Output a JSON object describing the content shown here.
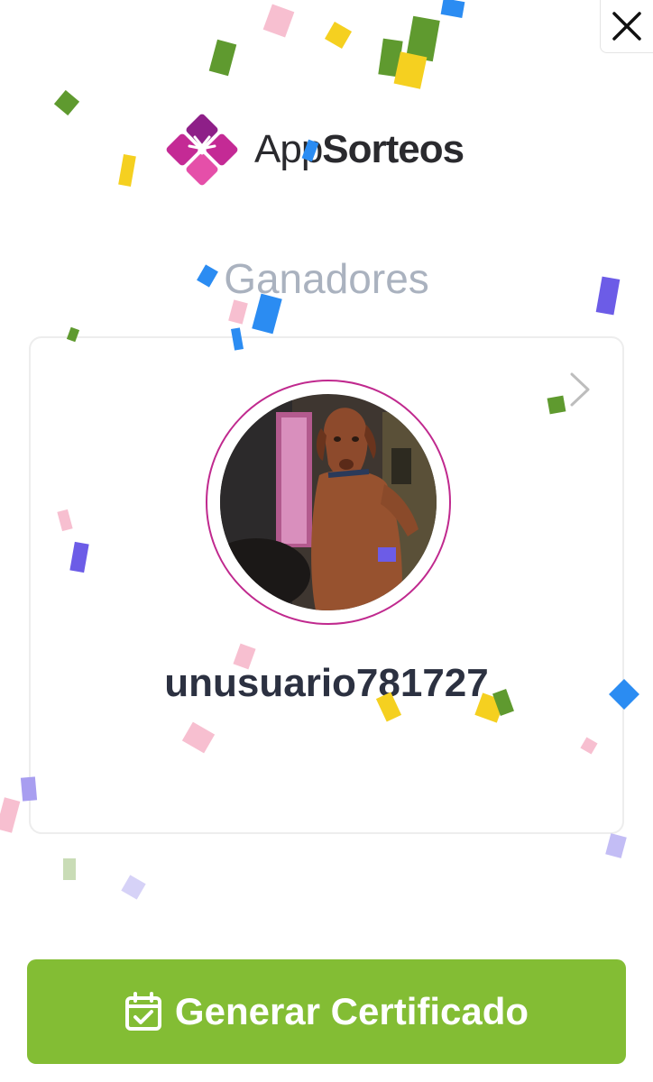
{
  "header": {
    "close_icon": "close-icon"
  },
  "logo": {
    "text_app": "App",
    "text_brand": "Sorteos",
    "colors": {
      "mark_dark": "#8e1f88",
      "mark_mid": "#c42a95",
      "mark_light": "#e54fa9"
    }
  },
  "winners": {
    "title": "Ganadores",
    "next_icon": "chevron-right-icon",
    "winner": {
      "username": "unusuario781727",
      "avatar_description": "avatar-image"
    }
  },
  "footer": {
    "button_label": "Generar Certificado",
    "button_icon": "calendar-check-icon",
    "button_color": "#83bd34"
  }
}
